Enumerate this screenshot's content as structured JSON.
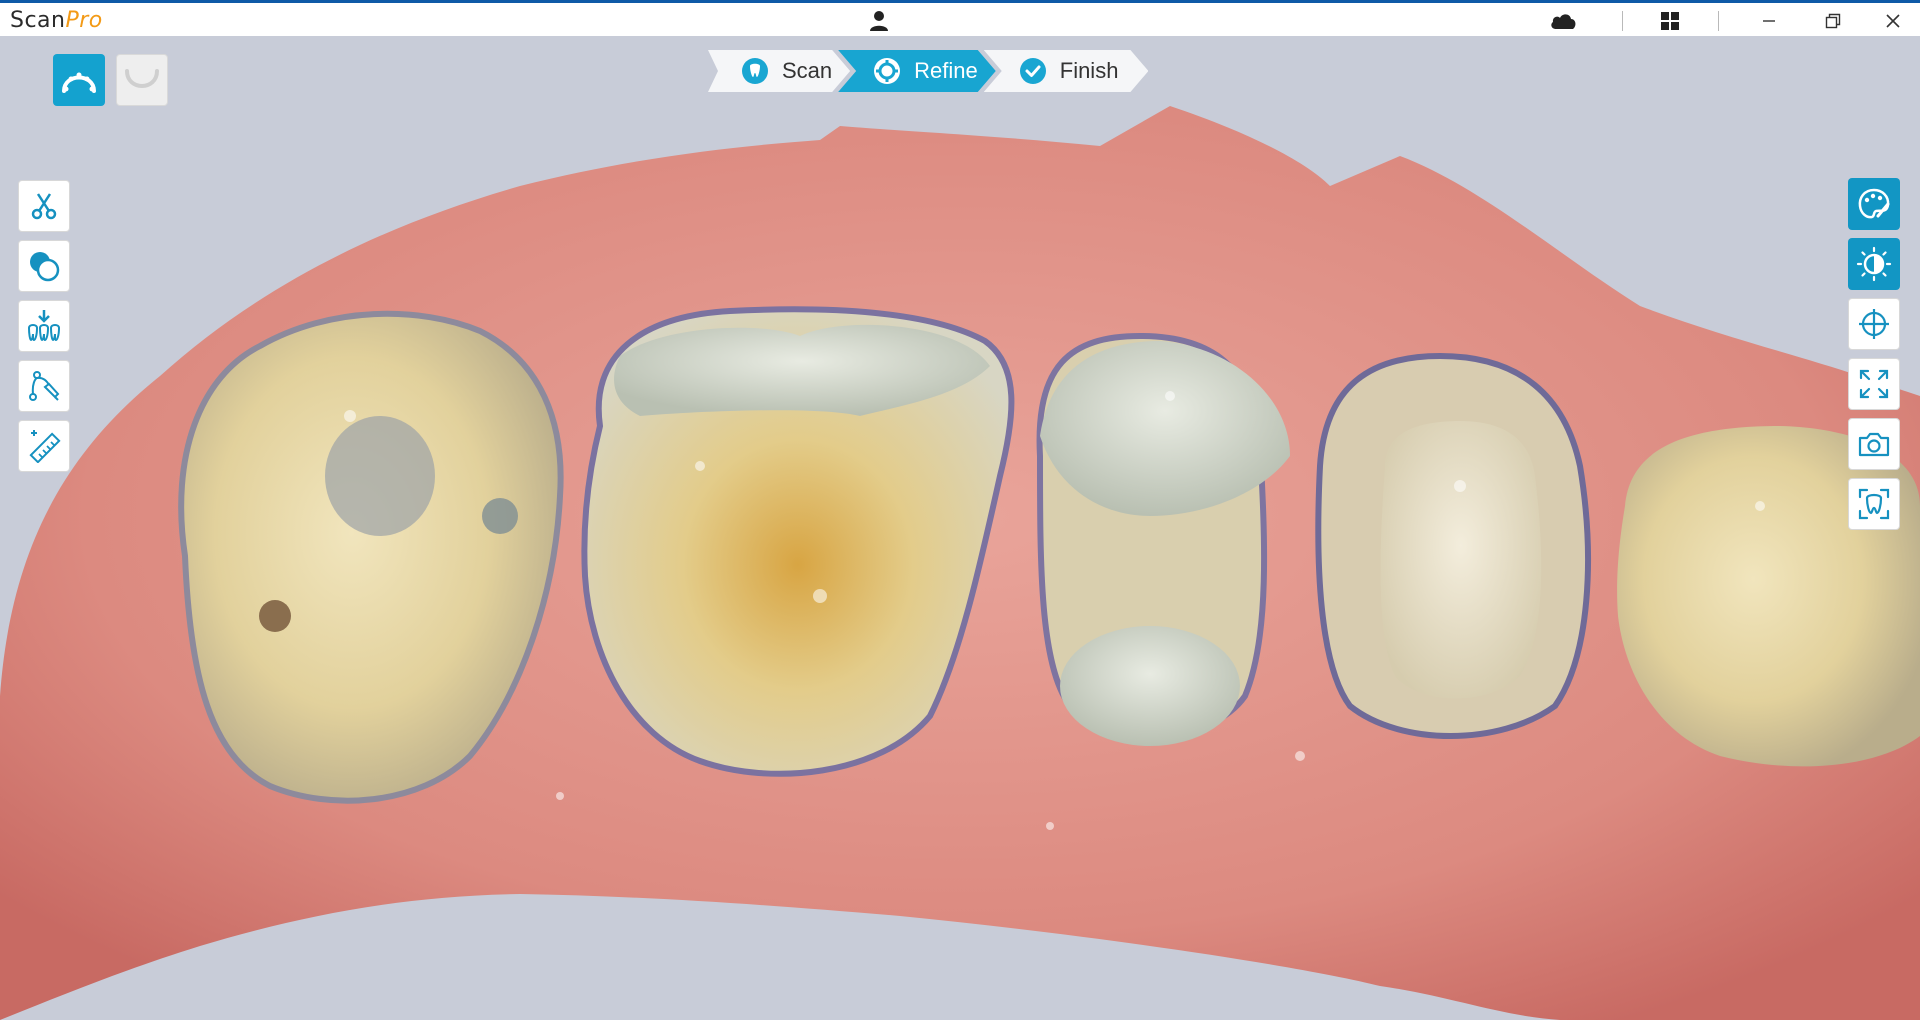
{
  "app": {
    "logo_part1": "Scan",
    "logo_part2": "Pro"
  },
  "titlebar": {
    "icons": [
      "user-icon",
      "cloud-icon",
      "apps-grid-icon",
      "minimize-icon",
      "restore-icon",
      "close-icon"
    ]
  },
  "jaw_toggle": {
    "items": [
      {
        "name": "upper-jaw",
        "icon": "upper-jaw-icon",
        "active": true
      },
      {
        "name": "lower-jaw",
        "icon": "lower-jaw-icon",
        "active": false
      }
    ]
  },
  "stepper": {
    "steps": [
      {
        "label": "Scan",
        "icon": "tooth-scan-icon",
        "state": "done"
      },
      {
        "label": "Refine",
        "icon": "gear-icon",
        "state": "current"
      },
      {
        "label": "Finish",
        "icon": "checkmark-icon",
        "state": "pending"
      }
    ]
  },
  "left_tools": [
    "scissors-icon",
    "overlap-circles-icon",
    "import-teeth-icon",
    "curve-pen-icon",
    "ruler-icon"
  ],
  "right_tools": [
    "palette-icon",
    "contrast-icon",
    "crosshair-icon",
    "fullscreen-icon",
    "camera-icon",
    "tooth-icon"
  ],
  "colors": {
    "accent": "#14a2cf",
    "titlebar_accent": "#0e5aa7",
    "logo_orange": "#f39a16",
    "viewport_bg": "#c8ccd8",
    "gum": "#d9867e",
    "tooth": "#e7dcbc"
  }
}
